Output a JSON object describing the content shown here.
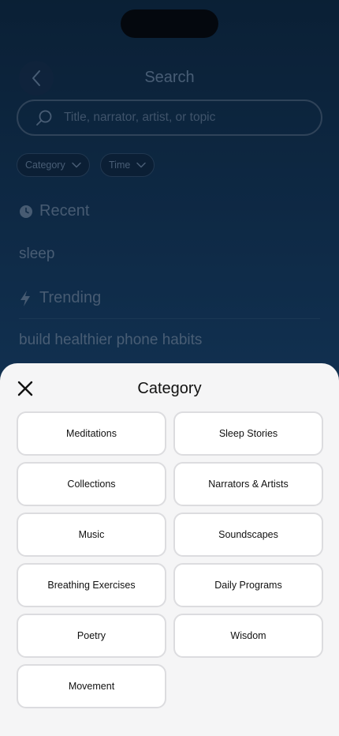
{
  "background": {
    "title": "Search",
    "search": {
      "placeholder": "Title, narrator, artist, or topic"
    },
    "filters": [
      {
        "label": "Category"
      },
      {
        "label": "Time"
      }
    ],
    "recent": {
      "heading": "Recent",
      "items": [
        "sleep"
      ]
    },
    "trending": {
      "heading": "Trending",
      "items": [
        "build healthier phone habits"
      ]
    }
  },
  "sheet": {
    "title": "Category",
    "categories": [
      "Meditations",
      "Sleep Stories",
      "Collections",
      "Narrators & Artists",
      "Music",
      "Soundscapes",
      "Breathing Exercises",
      "Daily Programs",
      "Poetry",
      "Wisdom",
      "Movement"
    ]
  },
  "colors": {
    "background_top": "#0b2740",
    "background_bottom": "#1c4f80",
    "sheet": "#f5f5f6",
    "card_border": "#dcdcdf"
  }
}
